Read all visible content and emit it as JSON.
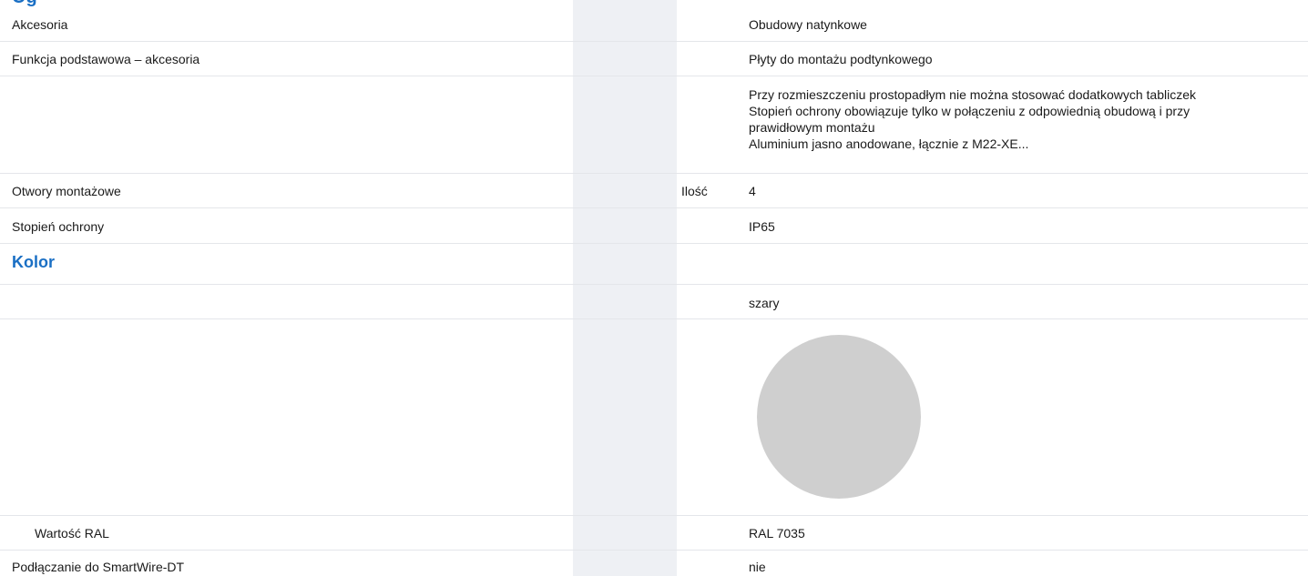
{
  "header": {
    "partial_heading": "Og"
  },
  "rows": [
    {
      "label": "Akcesoria",
      "unit": "",
      "value": "Obudowy natynkowe"
    },
    {
      "label": "Funkcja podstawowa – akcesoria",
      "unit": "",
      "value": "Płyty do montażu podtynkowego"
    },
    {
      "label": "",
      "unit": "",
      "notes": [
        "Przy rozmieszczeniu prostopadłym nie można stosować dodatkowych tabliczek",
        "Stopień ochrony obowiązuje tylko w połączeniu z odpowiednią obudową i przy",
        "prawidłowym montażu",
        "Aluminium jasno anodowane, łącznie z M22-XE..."
      ]
    },
    {
      "label": "Otwory montażowe",
      "unit": "Ilość",
      "value": "4"
    },
    {
      "label": "Stopień ochrony",
      "unit": "",
      "value": "IP65"
    }
  ],
  "color_section": {
    "title": "Kolor",
    "color_name": "szary",
    "swatch_color": "#cfcfcf",
    "ral_label": "Wartość RAL",
    "ral_value": "RAL 7035"
  },
  "smartwire": {
    "label": "Podłączanie do SmartWire-DT",
    "value": "nie"
  },
  "colors": {
    "accent": "#1a6fc4",
    "shaded_column": "#eef0f4",
    "row_border": "#e4e6ea"
  }
}
